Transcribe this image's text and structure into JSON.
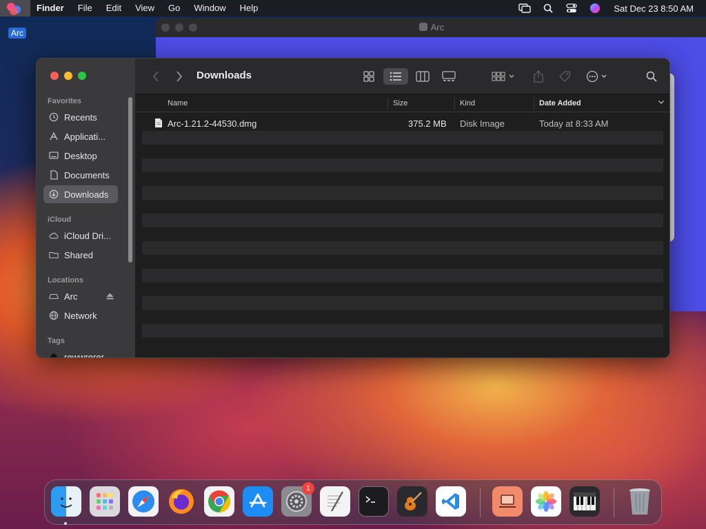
{
  "menubar": {
    "app_name": "Finder",
    "items": [
      "File",
      "Edit",
      "View",
      "Go",
      "Window",
      "Help"
    ],
    "clock": "Sat Dec 23  8:50 AM"
  },
  "desktop": {
    "label": "Arc"
  },
  "arc_window": {
    "title": "Arc"
  },
  "finder": {
    "title": "Downloads",
    "sidebar": {
      "favorites_header": "Favorites",
      "favorites": [
        "Recents",
        "Applicati...",
        "Desktop",
        "Documents",
        "Downloads"
      ],
      "icloud_header": "iCloud",
      "icloud": [
        "iCloud Dri...",
        "Shared"
      ],
      "locations_header": "Locations",
      "locations": [
        "Arc",
        "Network"
      ],
      "tags_header": "Tags",
      "tags": [
        "rewwrerer"
      ]
    },
    "columns": {
      "name": "Name",
      "size": "Size",
      "kind": "Kind",
      "date": "Date Added"
    },
    "files": [
      {
        "name": "Arc-1.21.2-44530.dmg",
        "size": "375.2 MB",
        "kind": "Disk Image",
        "date": "Today at 8:33 AM"
      }
    ]
  },
  "dock": {
    "settings_badge": "1"
  },
  "colors": {
    "accent": "#2a6ad6",
    "arc_blue": "#4d4de8",
    "red": "#ff5f57",
    "yellow": "#febc2e",
    "green": "#28c840"
  }
}
